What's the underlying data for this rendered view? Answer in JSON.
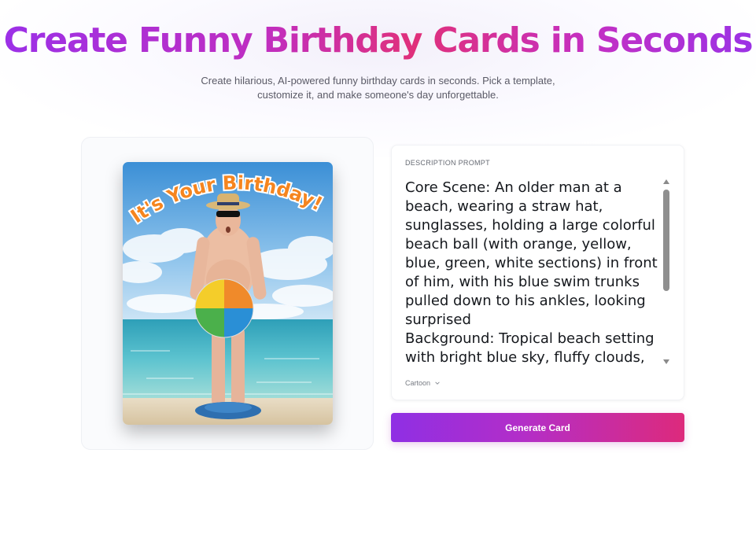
{
  "hero": {
    "title": "Create Funny Birthday Cards in Seconds",
    "subtitle": "Create hilarious, AI-powered funny birthday cards in seconds. Pick a template, customize it, and make someone's day unforgettable."
  },
  "card_preview": {
    "headline": "It's Your Birthday!",
    "image": "beach-man-with-beach-ball"
  },
  "prompt": {
    "label": "DESCRIPTION PROMPT",
    "text": "Core Scene: An older man at a beach, wearing a straw hat, sunglasses, holding a large colorful beach ball (with orange, yellow, blue, green, white sections) in front of him, with his blue swim trunks pulled down to his ankles, looking surprised\nBackground: Tropical beach setting with bright blue sky, fluffy clouds, turquoise ocean water, sandy shore",
    "style_value": "Cartoon"
  },
  "actions": {
    "generate_label": "Generate Card"
  },
  "colors": {
    "gradient_start": "#9b30e8",
    "gradient_end": "#e0307a"
  }
}
